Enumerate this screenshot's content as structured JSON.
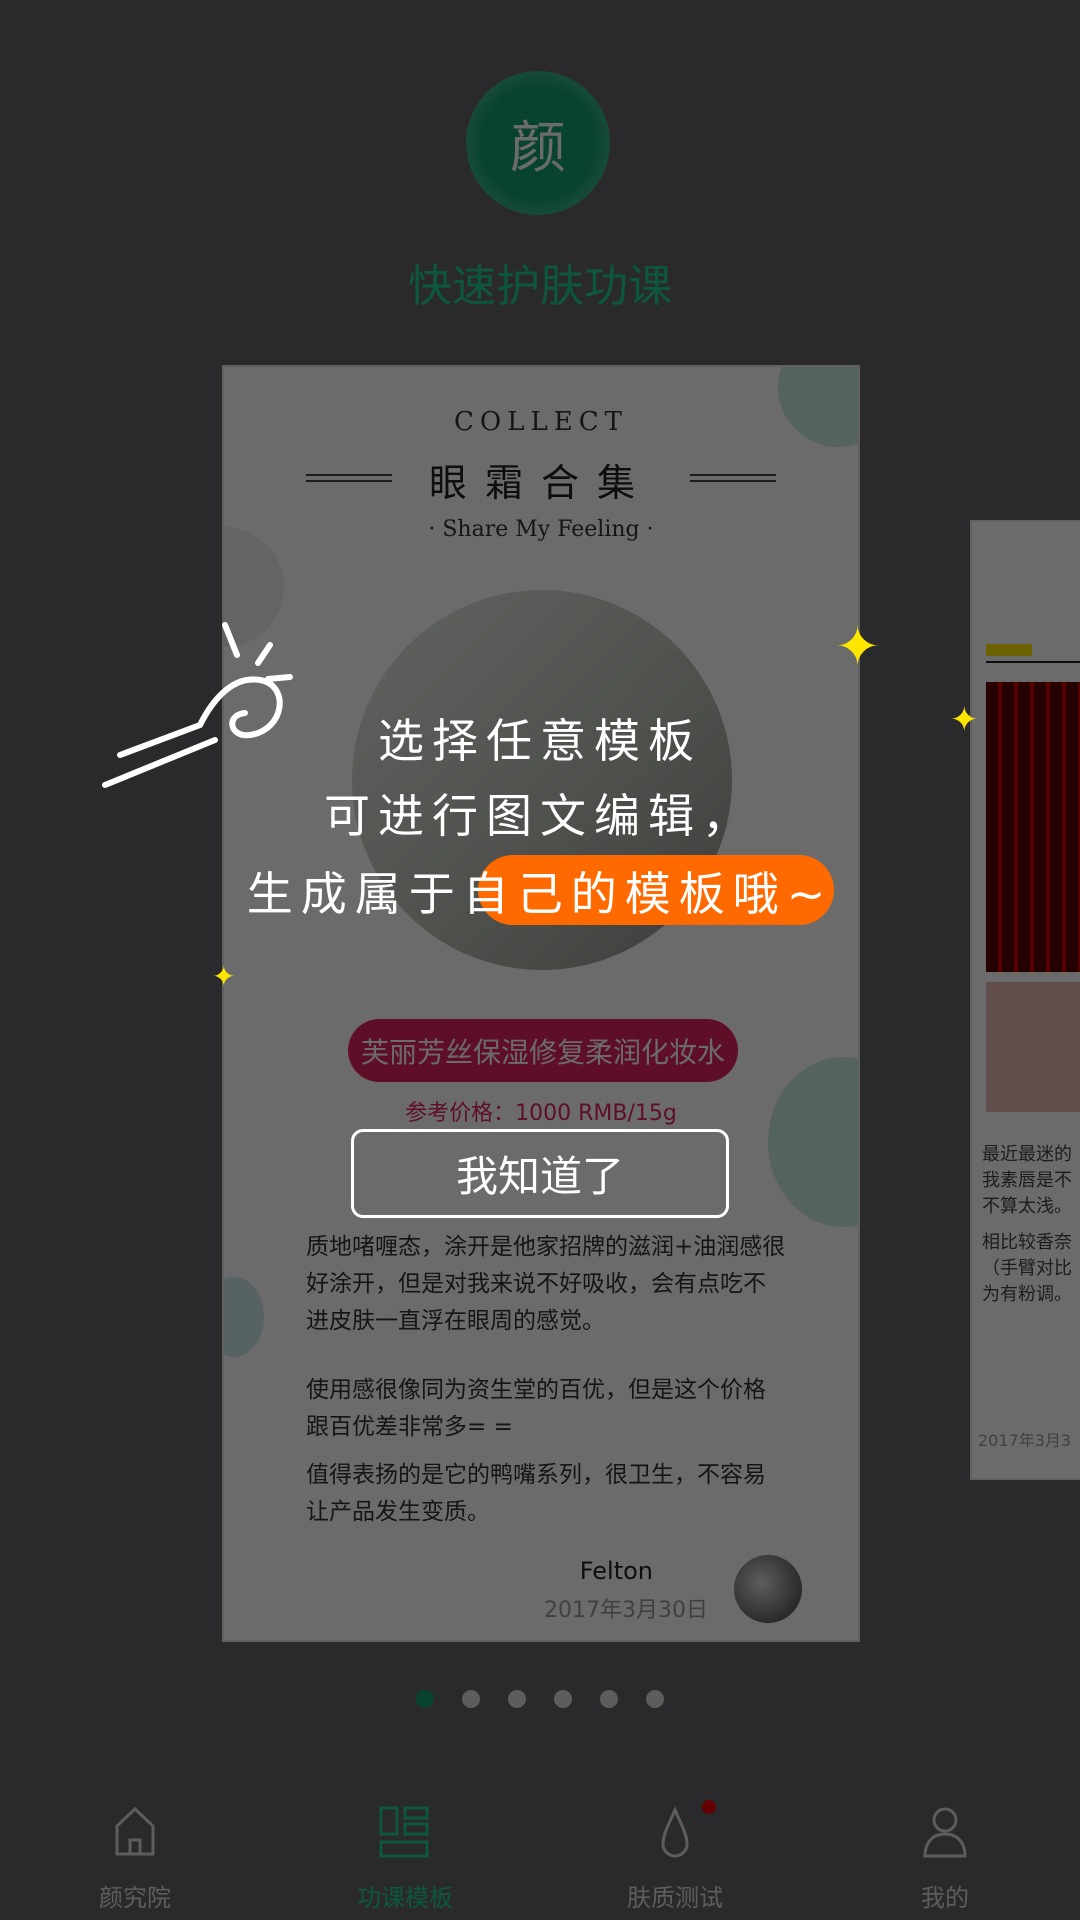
{
  "header": {
    "logo_char": "颜",
    "title": "快速护肤功课"
  },
  "card": {
    "collect": "COLLECT",
    "title": "眼霜合集",
    "subtitle": "· Share My Feeling ·",
    "product": "芙丽芳丝保湿修复柔润化妆水",
    "price": "参考价格：1000 RMB/15g",
    "paragraphs": [
      "质地啫喱态，涂开是他家招牌的滋润+油润感很好涂开，但是对我来说不好吸收，会有点吃不进皮肤一直浮在眼周的感觉。",
      "使用感很像同为资生堂的百优，但是这个价格跟百优差非常多= =",
      "值得表扬的是它的鸭嘴系列，很卫生，不容易让产品发生变质。"
    ],
    "author": "Felton",
    "date": "2017年3月30日"
  },
  "right_card": {
    "text": [
      "最近最迷的",
      "我素唇是不",
      "不算太浅。",
      "相比较香奈",
      "（手臂对比",
      "为有粉调。"
    ],
    "date": "2017年3月3"
  },
  "pagination": {
    "total": 6,
    "active": 0
  },
  "tabs": [
    {
      "label": "颜究院",
      "icon": "home-icon"
    },
    {
      "label": "功课模板",
      "icon": "template-icon",
      "active": true
    },
    {
      "label": "肤质测试",
      "icon": "drop-icon",
      "badge": true
    },
    {
      "label": "我的",
      "icon": "person-icon"
    }
  ],
  "overlay": {
    "line1": "选择任意模板",
    "line2": "可进行图文编辑，",
    "line3_pre": "生成属于",
    "line3_hl": "自己的模板",
    "line3_post": "哦~",
    "button": "我知道了",
    "highlight_color": "#ff6a00",
    "accent": "#12a070"
  }
}
